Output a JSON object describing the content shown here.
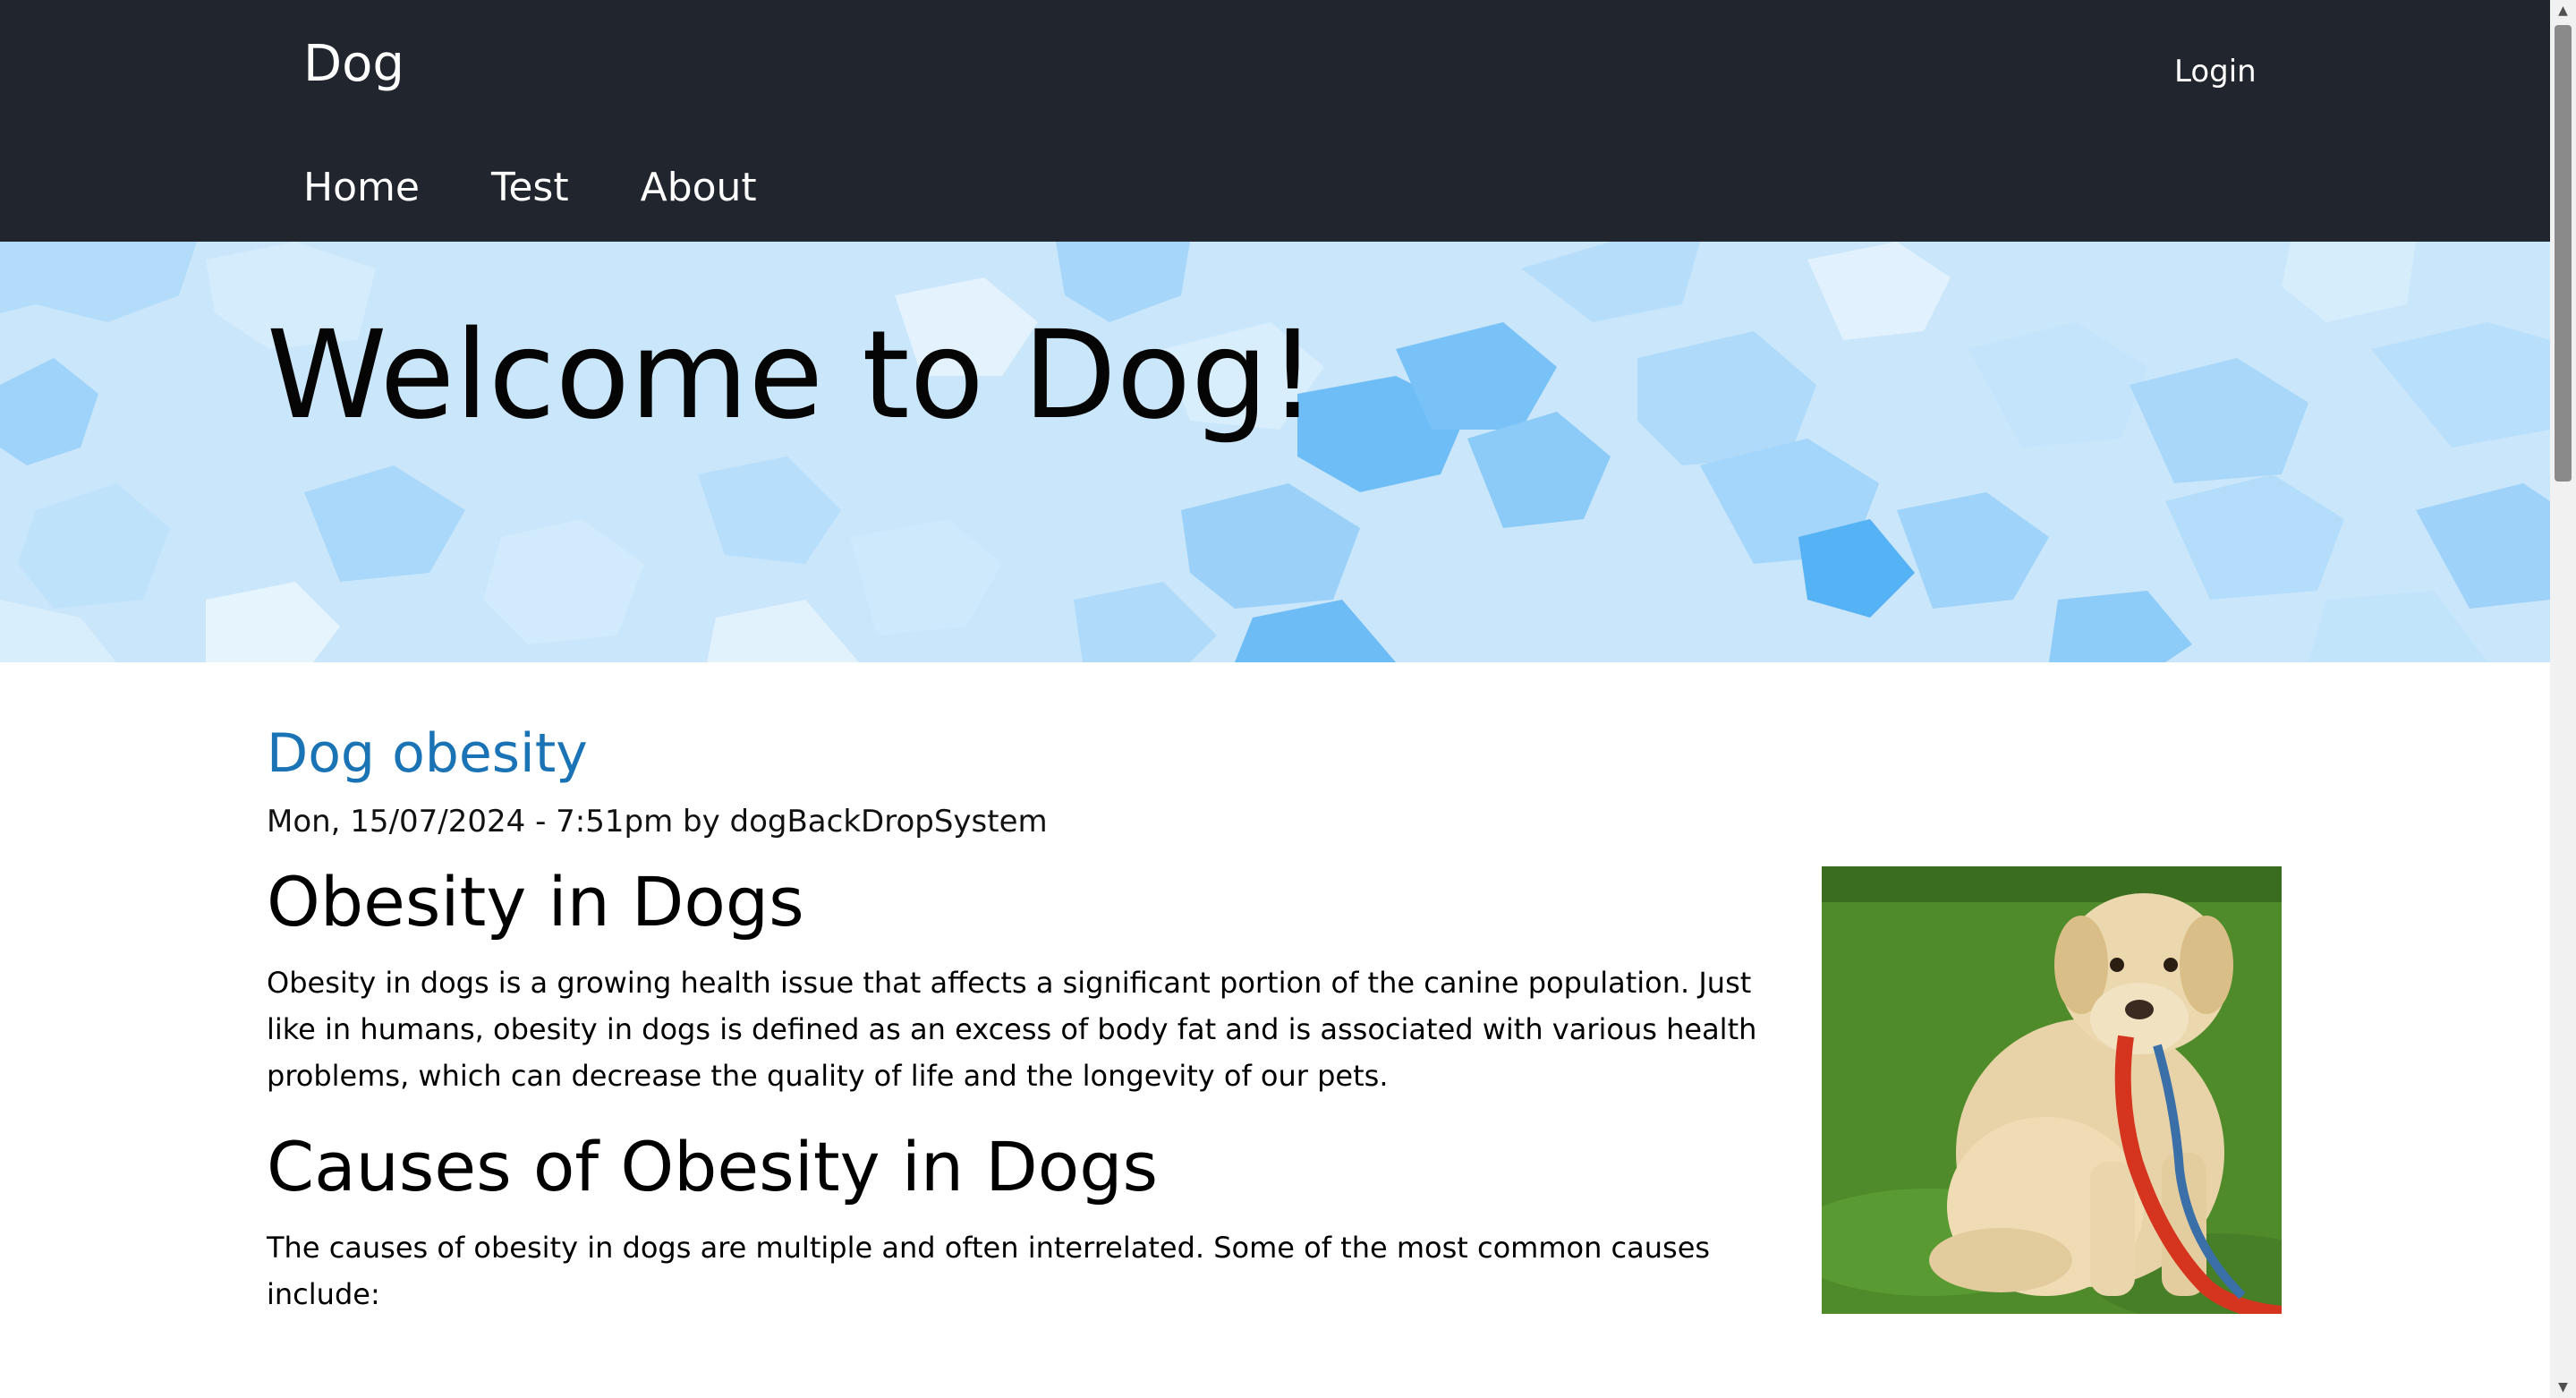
{
  "header": {
    "site_name": "Dog",
    "login_label": "Login",
    "nav": [
      {
        "label": "Home"
      },
      {
        "label": "Test"
      },
      {
        "label": "About"
      }
    ],
    "background_color": "#21252e"
  },
  "hero": {
    "title": "Welcome to Dog!",
    "background_color": "#c9e6fb"
  },
  "article": {
    "title": "Dog obesity",
    "title_color": "#1a73b5",
    "meta": "Mon, 15/07/2024 - 7:51pm by dogBackDropSystem",
    "sections": [
      {
        "heading": "Obesity in Dogs",
        "paragraph": "Obesity in dogs is a growing health issue that affects a significant portion of the canine population. Just like in humans, obesity in dogs is defined as an excess of body fat and is associated with various health problems, which can decrease the quality of life and the longevity of our pets."
      },
      {
        "heading": "Causes of Obesity in Dogs",
        "paragraph": "The causes of obesity in dogs are multiple and often interrelated. Some of the most common causes include:"
      }
    ],
    "image": {
      "icon": "dog-photo"
    }
  },
  "scrollbar": {
    "up_arrow": "▲",
    "down_arrow": "▼"
  }
}
